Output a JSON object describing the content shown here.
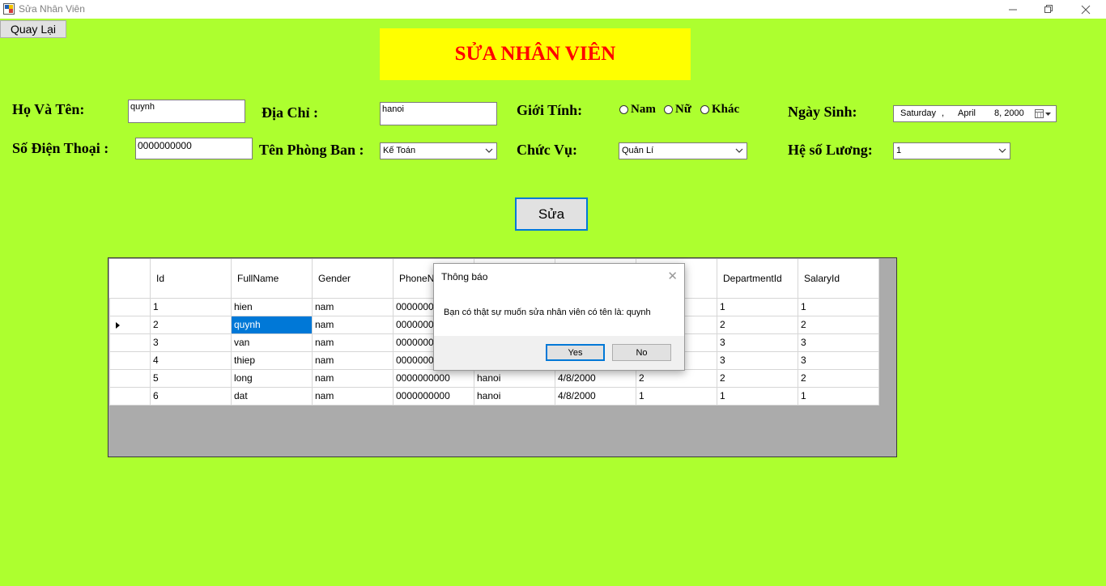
{
  "window": {
    "title": "Sửa Nhân Viên"
  },
  "back_button": "Quay Lại",
  "banner_title": "SỬA NHÂN VIÊN",
  "form": {
    "name_label": "Họ Và Tên:",
    "name_value": "quynh",
    "address_label": "Địa Chỉ :",
    "address_value": "hanoi",
    "gender_label": "Giới Tính:",
    "gender_options": [
      "Nam",
      "Nữ",
      "Khác"
    ],
    "dob_label": "Ngày Sinh:",
    "dob_weekday": "Saturday",
    "dob_sep": ",",
    "dob_month": "April",
    "dob_day_year": "8, 2000",
    "phone_label": "Số Điện Thoại :",
    "phone_value": "0000000000",
    "department_label": "Tên Phòng Ban :",
    "department_value": "Kế Toán",
    "position_label": "Chức Vụ:",
    "position_value": "Quản Lí",
    "salary_label": "Hệ số Lương:",
    "salary_value": "1"
  },
  "submit_button": "Sửa",
  "table": {
    "columns": [
      "Id",
      "FullName",
      "Gender",
      "PhoneNu",
      "",
      "",
      "",
      "DepartmentId",
      "SalaryId"
    ],
    "rows": [
      [
        "1",
        "hien",
        "nam",
        "00000000",
        "",
        "",
        "",
        "1",
        "1"
      ],
      [
        "2",
        "quynh",
        "nam",
        "00000000",
        "",
        "",
        "",
        "2",
        "2"
      ],
      [
        "3",
        "van",
        "nam",
        "00000000",
        "",
        "",
        "",
        "3",
        "3"
      ],
      [
        "4",
        "thiep",
        "nam",
        "00000000",
        "",
        "",
        "",
        "3",
        "3"
      ],
      [
        "5",
        "long",
        "nam",
        "0000000000",
        "hanoi",
        "4/8/2000",
        "2",
        "2",
        "2"
      ],
      [
        "6",
        "dat",
        "nam",
        "0000000000",
        "hanoi",
        "4/8/2000",
        "1",
        "1",
        "1"
      ]
    ],
    "current_row_index": 1
  },
  "dialog": {
    "title": "Thông báo",
    "message": "Bạn có thật sự muốn sửa nhân viên có tên là: quynh",
    "yes": "Yes",
    "no": "No"
  },
  "colors": {
    "background": "#ADFF2F",
    "banner_bg": "#FFFF00",
    "banner_text": "#FF0000",
    "selection": "#0078d7"
  }
}
